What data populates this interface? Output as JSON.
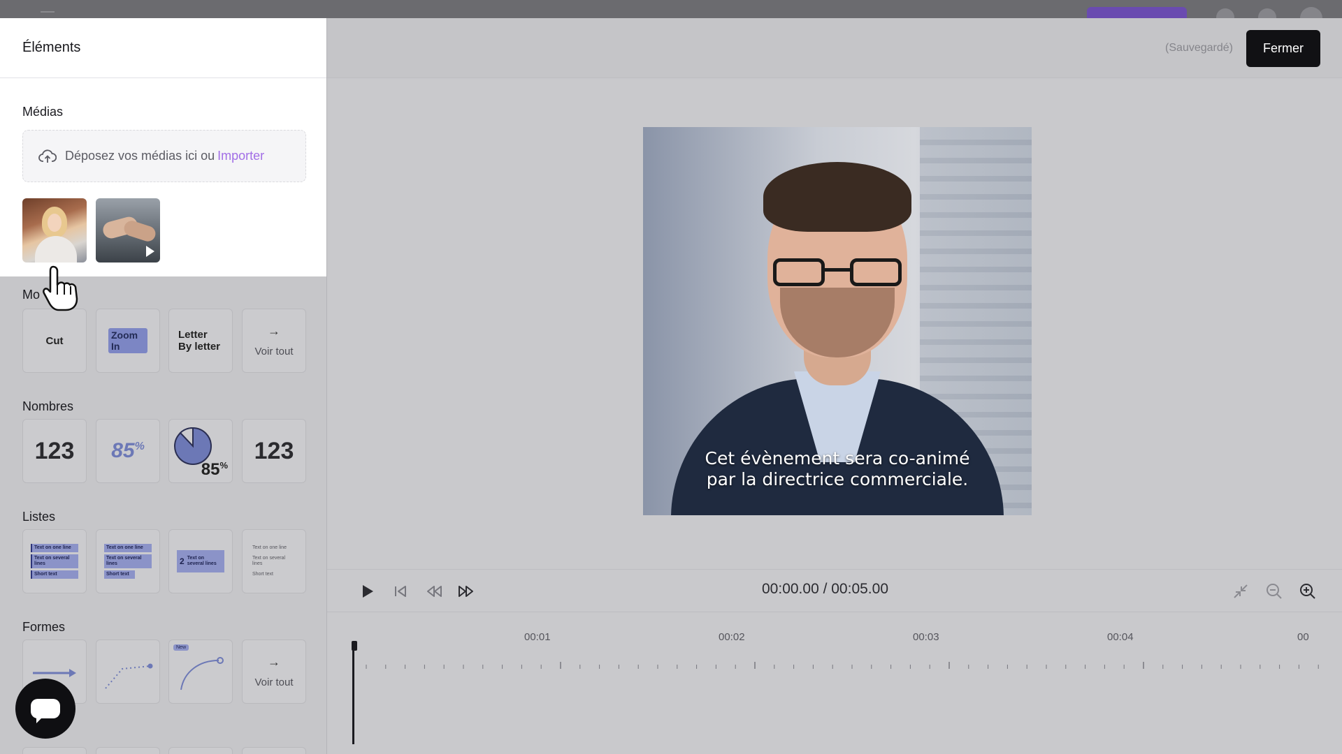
{
  "panel": {
    "title": "Éléments",
    "media": {
      "title": "Médias",
      "drop_text": "Déposez vos médias ici ou",
      "import_link": "Importer"
    },
    "motion": {
      "title": "Mo",
      "tiles": {
        "cut": "Cut",
        "zoom": "Zoom In",
        "letter": "Letter By letter",
        "see_all": "Voir tout"
      }
    },
    "numbers": {
      "title": "Nombres",
      "tile1": "123",
      "tile2": "85",
      "tile2_unit": "%",
      "tile3": "85",
      "tile3_unit": "%",
      "tile4": "123"
    },
    "lists": {
      "title": "Listes",
      "row1": "Text on one line",
      "row2": "Text on several lines",
      "row3": "Short text",
      "num_row": "Text on several lines",
      "num_index": "2"
    },
    "shapes": {
      "title": "Formes",
      "see_all": "Voir tout",
      "badge": "New"
    }
  },
  "header": {
    "saved_label": "(Sauvegardé)",
    "close_label": "Fermer"
  },
  "preview": {
    "caption_line1": "Cet évènement sera co-animé",
    "caption_line2": "par la directrice commerciale."
  },
  "player": {
    "time": "00:00.00 / 00:05.00"
  },
  "timeline": {
    "marks": [
      "00:01",
      "00:02",
      "00:03",
      "00:04",
      "00"
    ]
  },
  "colors": {
    "accent": "#a26ee6",
    "dark_button": "#111114"
  }
}
